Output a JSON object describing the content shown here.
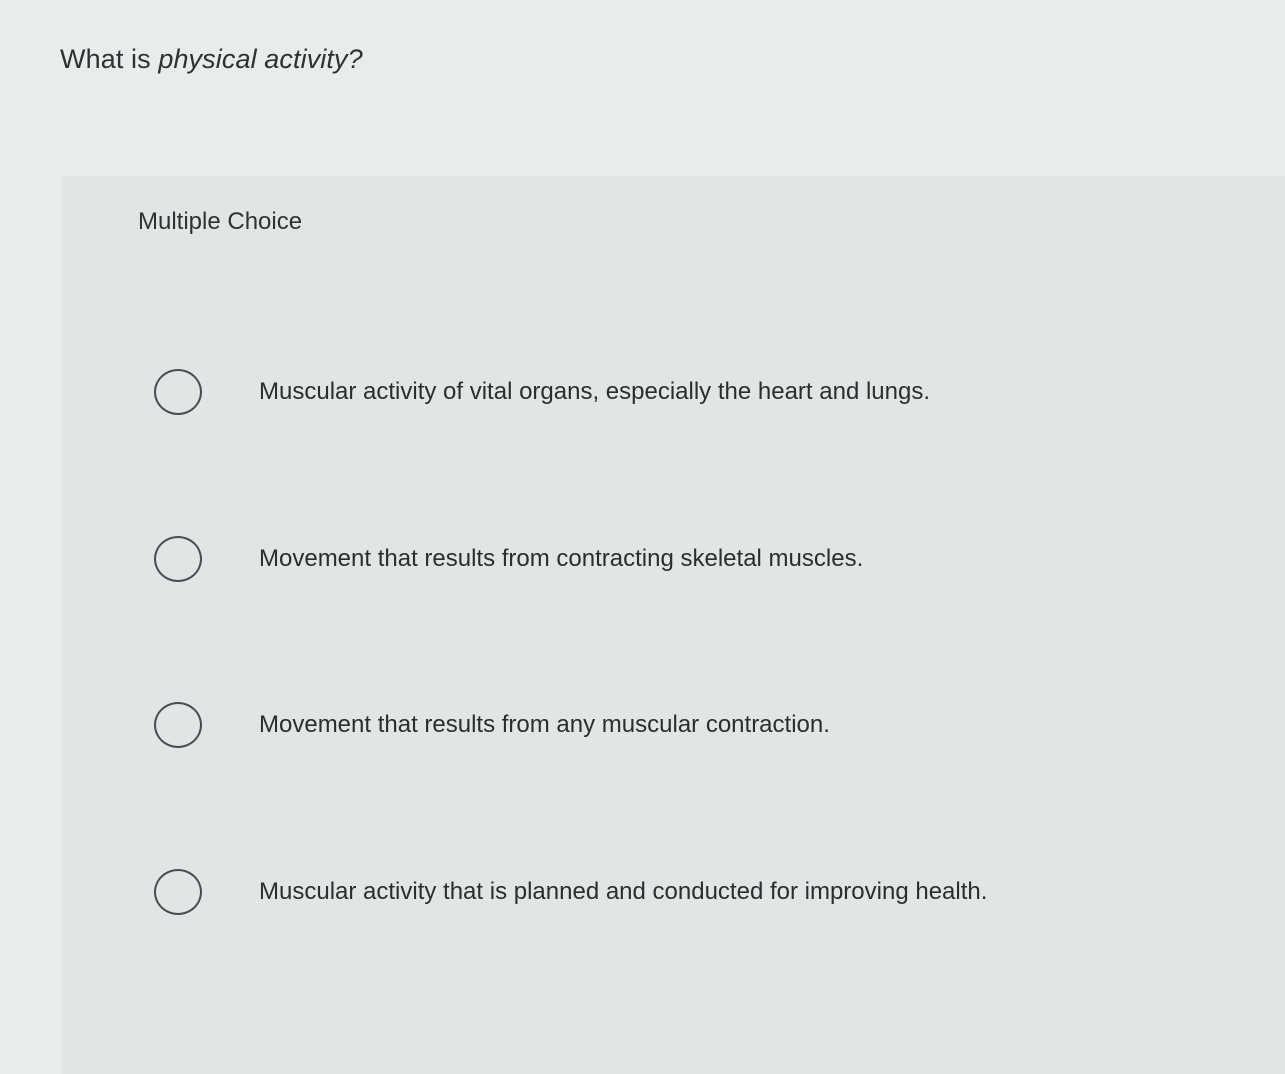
{
  "question": {
    "prefix": "What is ",
    "emphasis": "physical activity?"
  },
  "section_label": "Multiple Choice",
  "options": [
    {
      "label": "Muscular activity of vital organs, especially the heart and lungs.",
      "selected": false
    },
    {
      "label": "Movement that results from contracting skeletal muscles.",
      "selected": false
    },
    {
      "label": "Movement that results from any muscular contraction.",
      "selected": false
    },
    {
      "label": "Muscular activity that is planned and conducted for improving health.",
      "selected": false
    }
  ]
}
